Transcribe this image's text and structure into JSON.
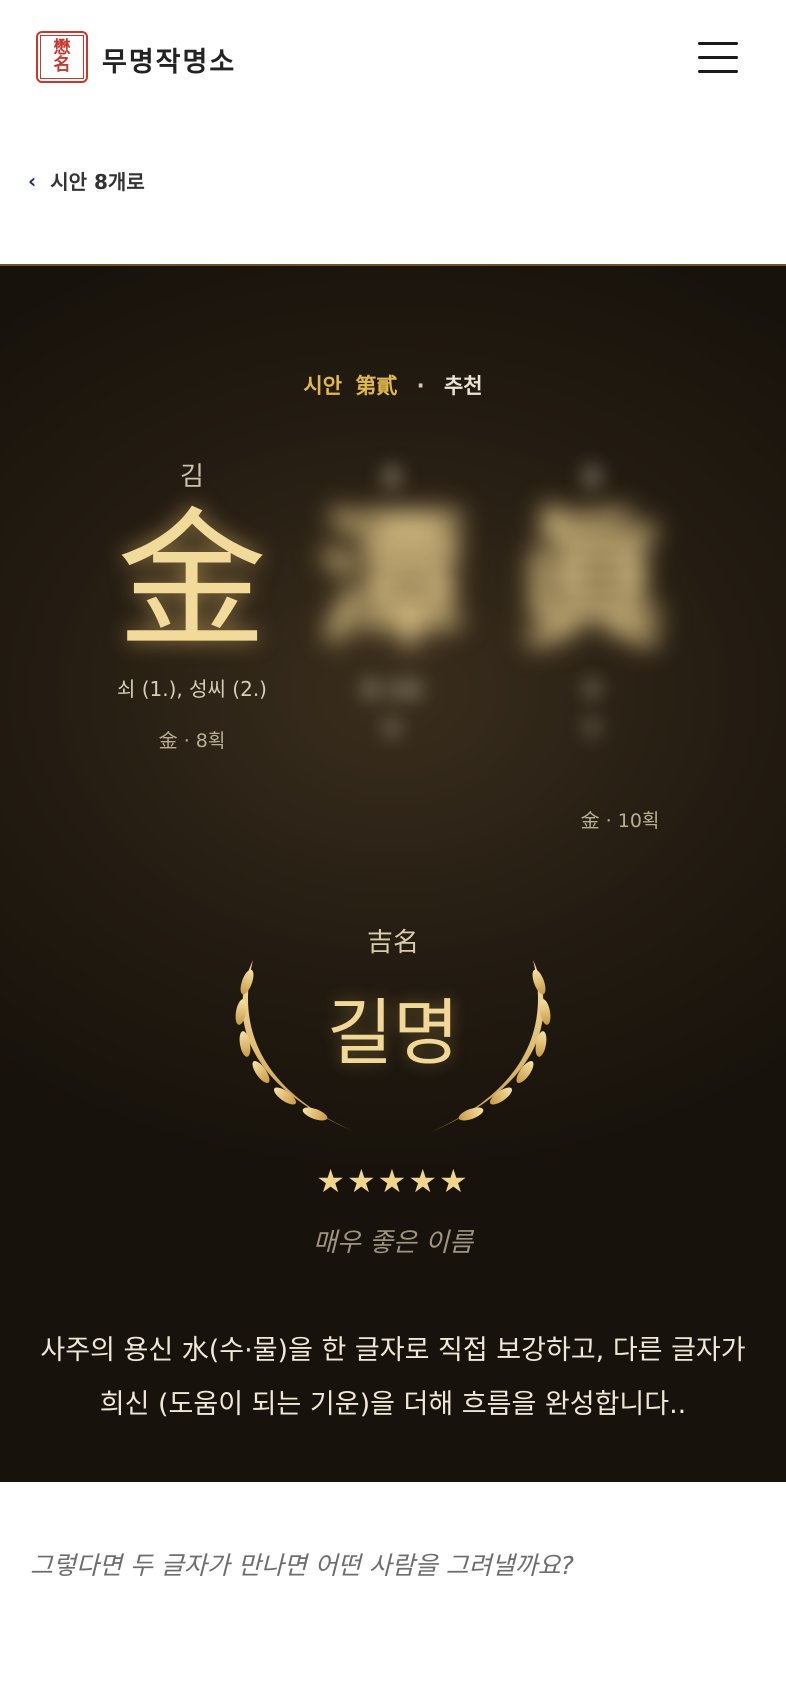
{
  "header": {
    "logo_chars": [
      "懋",
      "名"
    ],
    "brand": "무명작명소",
    "menu_icon": "hamburger-menu-icon"
  },
  "nav": {
    "back_label": "시안 8개로",
    "back_icon": "chevron-left-icon"
  },
  "card": {
    "eyebrow": {
      "label": "시안",
      "ordinal": "第貳",
      "separator": "·",
      "tag": "추천"
    },
    "characters": [
      {
        "hangul": "김",
        "hanja": "金",
        "meaning": "쇠 (1.), 성씨 (2.)",
        "stroke": "金 · 8획",
        "blurred": false
      },
      {
        "hangul": "숨",
        "hanja": "潭",
        "meaning": "물 깊을",
        "meaning2": "담",
        "stroke": "",
        "blurred": true
      },
      {
        "hangul": "숨",
        "hanja": "眞",
        "meaning": "참",
        "meaning2": "진",
        "stroke": "金 · 10획",
        "blurred": true
      }
    ],
    "rating": {
      "hanja": "吉名",
      "title": "길명",
      "stars": "★★★★★",
      "verdict": "매우 좋은 이름"
    },
    "description": "사주의 용신 水(수·물)을 한 글자로 직접 보강하고, 다른 글자가 희신 (도움이 되는 기운)을 더해 흐름을 완성합니다.."
  },
  "question": "그렇다면 두 글자가 만나면 어떤 사람을 그려낼까요?",
  "colors": {
    "gold": "#e0b84e",
    "panel": "#241c12",
    "seal_red": "#c8382e",
    "back_chevron": "#1e2a7a"
  }
}
